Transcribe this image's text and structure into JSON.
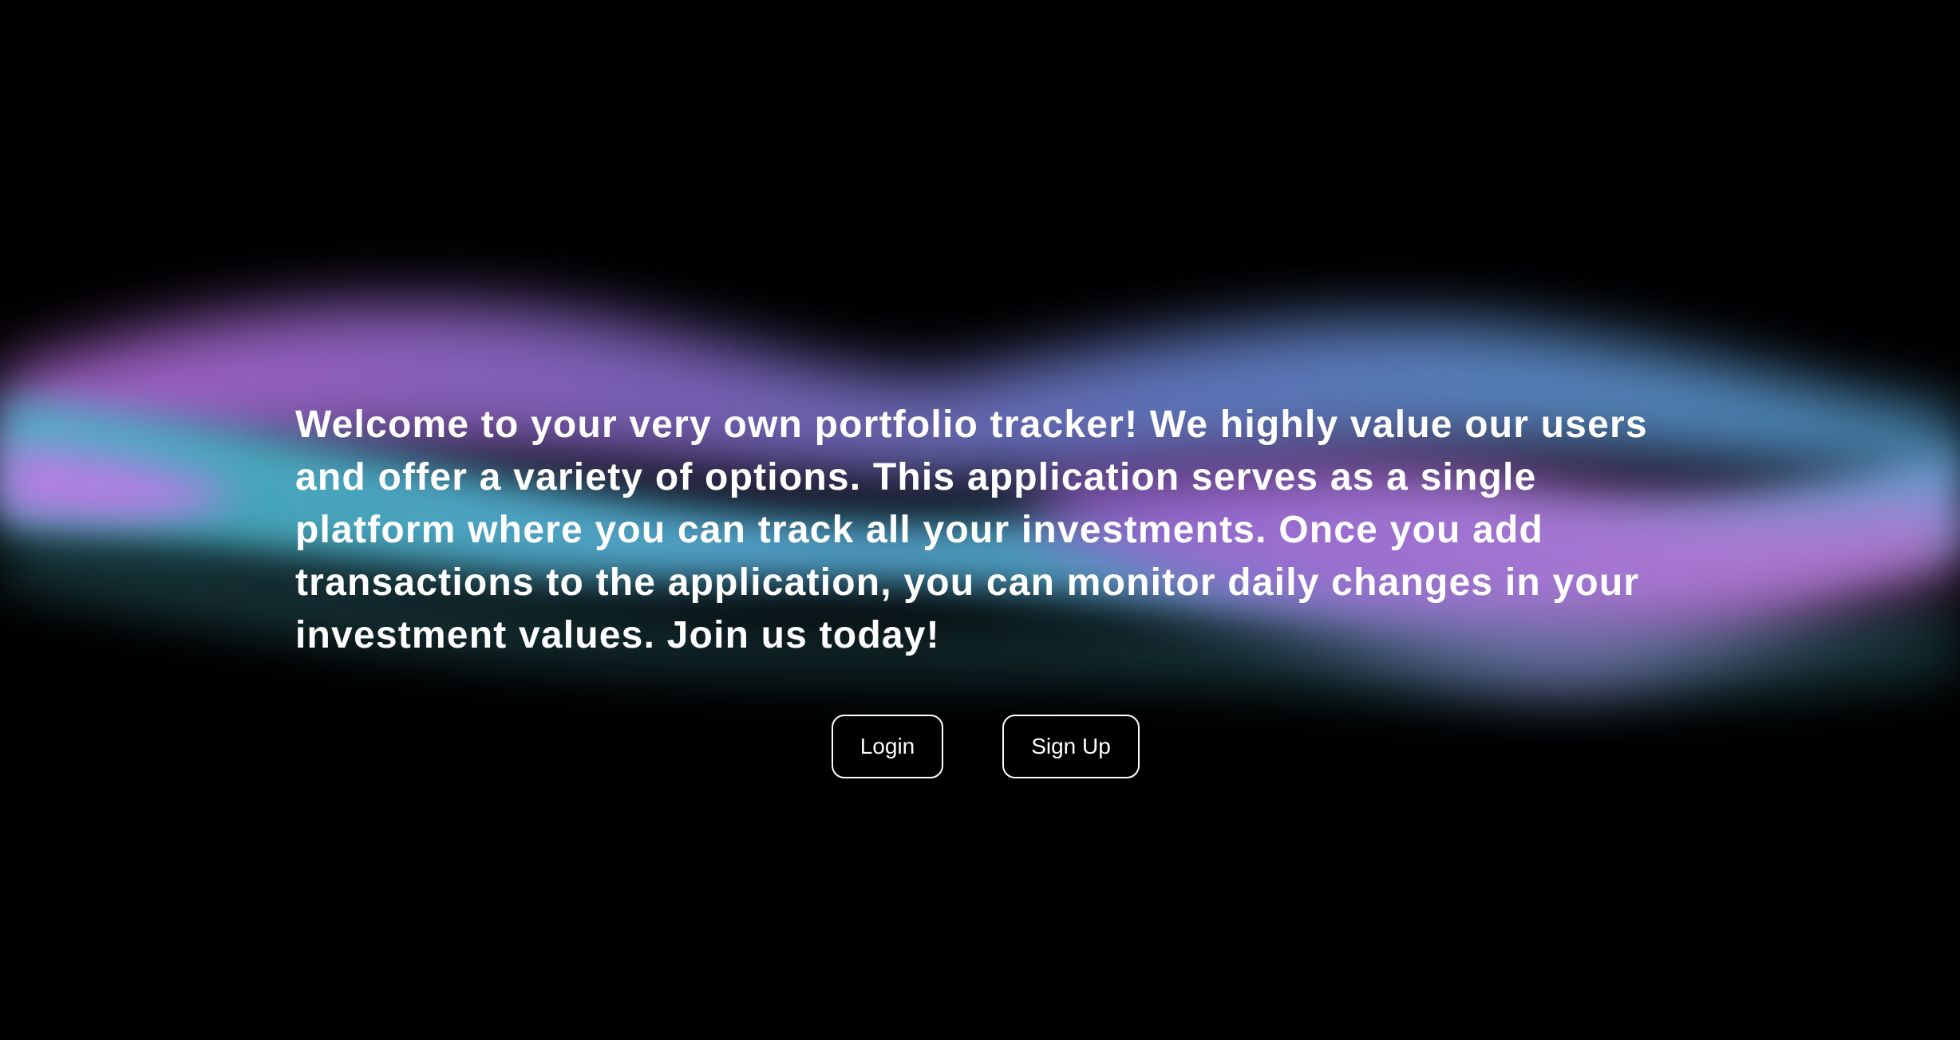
{
  "hero": {
    "text": "Welcome to your very own portfolio tracker! We highly value our users and offer a variety of options. This application serves as a single platform where you can track all your investments. Once you add transactions to the application, you can monitor daily changes in your investment values. Join us today!"
  },
  "actions": {
    "login_label": "Login",
    "signup_label": "Sign Up"
  },
  "colors": {
    "background": "#000000",
    "text": "#ffffff",
    "aurora_purple": "#b46be0",
    "aurora_blue": "#5ea6d8",
    "aurora_teal": "#3f8f9c"
  }
}
